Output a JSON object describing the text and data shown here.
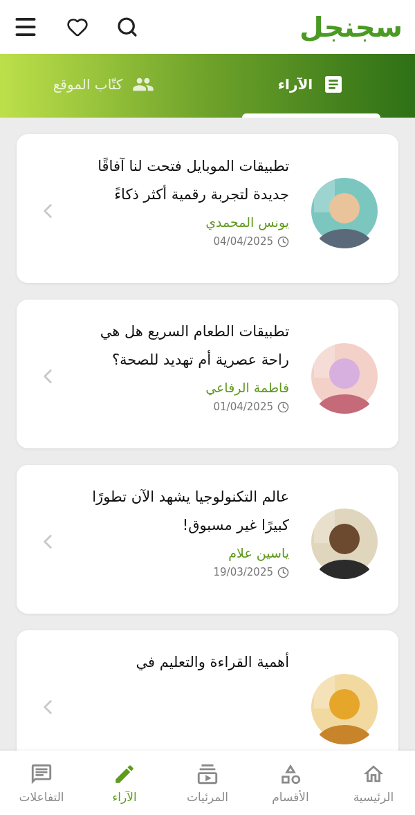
{
  "header": {
    "logo": "سجنجل"
  },
  "tabs": [
    {
      "label": "الآراء",
      "selected": true
    },
    {
      "label": "كتّاب الموقع",
      "selected": false
    }
  ],
  "articles": [
    {
      "title": "تطبيقات الموبايل فتحت لنا آفاقًا جديدة لتجربة رقمية أكثر ذكاءً",
      "author": "يونس المحمدي",
      "date": "04/04/2025"
    },
    {
      "title": "تطبيقات الطعام السريع هل هي راحة عصرية أم تهديد للصحة؟",
      "author": "فاطمة الرفاعي",
      "date": "01/04/2025"
    },
    {
      "title": "عالم التكنولوجيا يشهد الآن تطورًا كبيرًا غير مسبوق!",
      "author": "ياسين علام",
      "date": "19/03/2025"
    },
    {
      "title": "أهمية القراءة والتعليم في"
    }
  ],
  "bottom_nav": [
    {
      "label": "الرئيسية",
      "selected": false
    },
    {
      "label": "الأقسام",
      "selected": false
    },
    {
      "label": "المرئيات",
      "selected": false
    },
    {
      "label": "الآراء",
      "selected": true
    },
    {
      "label": "التفاعلات",
      "selected": false
    }
  ]
}
